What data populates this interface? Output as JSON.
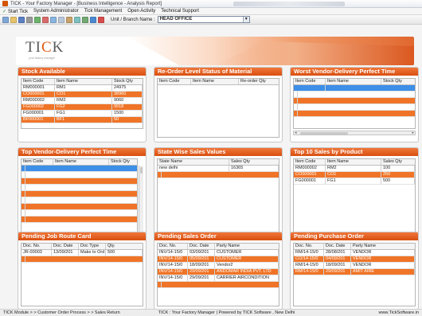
{
  "window": {
    "title": "TICK - Your Factory Manager - [Business Intelligence - Analysis Report]"
  },
  "menu": {
    "items": [
      "Start Tick",
      "System Administrator",
      "Tick Management",
      "Open Activity",
      "Technical Support"
    ]
  },
  "toolbar": {
    "unit_label": "Unit / Branch Name :",
    "branch_value": "HEAD OFFICE",
    "icons": [
      "new-icon",
      "open-icon",
      "save-icon",
      "print-icon",
      "preview-icon",
      "find-icon",
      "cut-icon",
      "copy-icon",
      "paste-icon",
      "undo-icon",
      "redo-icon",
      "help-icon",
      "exit-icon"
    ]
  },
  "banner": {
    "logo_text": "TICK",
    "logo_sub": "your factory manager"
  },
  "panels": {
    "stock_available": {
      "title": "Stock Available",
      "columns": [
        "Item Code",
        "Item Name",
        "Stock Qty"
      ],
      "rows": [
        [
          "RM000001",
          "RM1",
          "24975"
        ],
        [
          "CO000001",
          "CO1",
          "38960"
        ],
        [
          "RM000002",
          "RM2",
          "9060"
        ],
        [
          "FG000002",
          "FG2",
          "9918"
        ],
        [
          "FG000001",
          "FG1",
          "1500"
        ],
        [
          "BF000001",
          "BF1",
          "50"
        ]
      ]
    },
    "reorder": {
      "title": "Re-Order Level Status of Material",
      "columns": [
        "Item Code",
        "Item Name",
        "Re-order Qty"
      ]
    },
    "worst_vendor": {
      "title": "Worst Vendor-Delivery Perfect Time",
      "columns": [
        "Item Code",
        "Item Name",
        "Stock Qty"
      ]
    },
    "top_vendor": {
      "title": "Top Vendor-Delivery Perfect Time",
      "columns": [
        "Item Code",
        "Item Name",
        "Stock Qty"
      ]
    },
    "state_sales": {
      "title": "State Wise Sales Values",
      "columns": [
        "State Name",
        "Sales Qty"
      ],
      "rows": [
        [
          "new delhi",
          "16365"
        ]
      ]
    },
    "top_sales": {
      "title": "Top 10 Sales by Product",
      "columns": [
        "Item Code",
        "Item Name",
        "Sales Qty"
      ],
      "rows": [
        [
          "RM000002",
          "RM2",
          "100"
        ],
        [
          "CO000001",
          "CO1",
          "250"
        ],
        [
          "FG000001",
          "FG1",
          "500"
        ]
      ]
    },
    "job_route": {
      "title": "Pending Job Route Card",
      "columns": [
        "Doc. No.",
        "Doc. Date",
        "Doc Type",
        "Qty."
      ],
      "rows": [
        [
          "JR-00003",
          "13/09/201",
          "Make to Ord",
          "500"
        ]
      ]
    },
    "sales_order": {
      "title": "Pending Sales Order",
      "columns": [
        "Doc. No.",
        "Doc. Date",
        "Party Name"
      ],
      "rows": [
        [
          "INV/14-15/0",
          "03/09/201",
          "CUSTOMER"
        ],
        [
          "INV/14-15/0",
          "05/09/201",
          "CUSTOMER"
        ],
        [
          "INV/14-15/0",
          "18/09/201",
          "Vendor2"
        ],
        [
          "INV/14-15/0",
          "29/09/201",
          "ANDOMAR INDIA PVT. LTD"
        ],
        [
          "INV/14-15/0",
          "29/09/201",
          "CARRIER AIRCONDITION"
        ]
      ]
    },
    "purchase_order": {
      "title": "Pending Purchase Order",
      "columns": [
        "Doc. No.",
        "Doc. Date",
        "Party Name"
      ],
      "rows": [
        [
          "RM/14-15/0",
          "28/08/201",
          "VENDOR"
        ],
        [
          "CO/14-15/0",
          "04/09/201",
          "VENDOR"
        ],
        [
          "RM/14-15/0",
          "18/09/201",
          "VENDOR"
        ],
        [
          "RM/14-15/0",
          "29/09/201",
          "AMIT AIRE"
        ]
      ]
    }
  },
  "statusbar": {
    "left": "TICK Module > > Customer Order Process > > Sales Return",
    "center": "TICK : Your Factory Manager  |  Powered by TICK Software , New Delhi",
    "right": "www.TickSoftware.in"
  },
  "colors": {
    "accent": "#e05a12",
    "row_orange": "#f07427",
    "selection": "#3d8fe8"
  }
}
